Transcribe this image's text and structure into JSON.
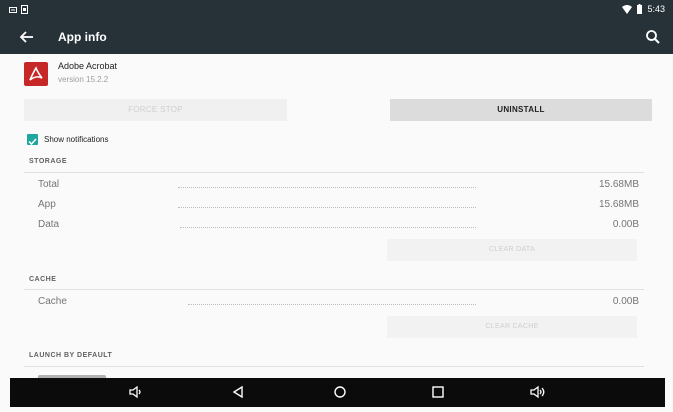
{
  "status_bar": {
    "time": "5:43",
    "left_icons": [
      "notification-icon",
      "sim-icon"
    ],
    "right_icons": [
      "wifi-icon",
      "battery-icon"
    ]
  },
  "app_bar": {
    "title": "App info",
    "back_icon": "arrow-left-icon",
    "search_icon": "search-icon"
  },
  "app": {
    "name": "Adobe Acrobat",
    "version": "version 15.2.2",
    "icon": "acrobat-icon"
  },
  "actions": {
    "force_stop": "FORCE STOP",
    "uninstall": "UNINSTALL"
  },
  "notifications": {
    "label": "Show notifications",
    "checked": true
  },
  "storage": {
    "header": "STORAGE",
    "rows": [
      {
        "label": "Total",
        "value": "15.68MB"
      },
      {
        "label": "App",
        "value": "15.68MB"
      },
      {
        "label": "Data",
        "value": "0.00B"
      }
    ],
    "clear_label": "CLEAR DATA"
  },
  "cache": {
    "header": "CACHE",
    "rows": [
      {
        "label": "Cache",
        "value": "0.00B"
      }
    ],
    "clear_label": "CLEAR CACHE"
  },
  "launch": {
    "header": "LAUNCH BY DEFAULT"
  },
  "nav_bar": {
    "buttons": [
      "volume-down-icon",
      "back-icon",
      "home-icon",
      "recents-icon",
      "volume-up-icon"
    ]
  },
  "colors": {
    "toolbar": "#263238",
    "accent": "#1ea7a0",
    "acrobat_red": "#c62828"
  }
}
